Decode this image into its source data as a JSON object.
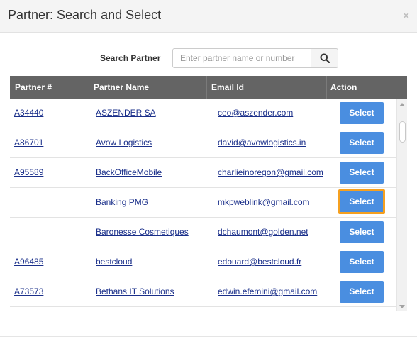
{
  "modal": {
    "title": "Partner: Search and Select",
    "close_label": "×"
  },
  "search": {
    "label": "Search Partner",
    "placeholder": "Enter partner name or number",
    "value": "",
    "button_icon": "search-icon"
  },
  "table": {
    "headers": {
      "partner_no": "Partner #",
      "partner_name": "Partner Name",
      "email": "Email Id",
      "action": "Action"
    },
    "select_label": "Select",
    "rows": [
      {
        "partner_no": "A34440",
        "partner_name": "ASZENDER SA",
        "email": "ceo@aszender.com"
      },
      {
        "partner_no": "A86701",
        "partner_name": "Avow Logistics",
        "email": "david@avowlogistics.in"
      },
      {
        "partner_no": "A95589",
        "partner_name": "BackOfficeMobile",
        "email": "charlieinoregon@gmail.com"
      },
      {
        "partner_no": "",
        "partner_name": "Banking PMG",
        "email": "mkpweblink@gmail.com",
        "focused": true
      },
      {
        "partner_no": "",
        "partner_name": "Baronesse Cosmetiques",
        "email": "dchaumont@golden.net"
      },
      {
        "partner_no": "A96485",
        "partner_name": "bestcloud",
        "email": "edouard@bestcloud.fr"
      },
      {
        "partner_no": "A73573",
        "partner_name": "Bethans IT Solutions",
        "email": "edwin.efemini@gmail.com"
      },
      {
        "partner_no": "",
        "partner_name": "",
        "email": ""
      }
    ]
  },
  "colors": {
    "header_bg": "#646464",
    "select_button": "#4a8ee0",
    "focus_ring": "#f5a020",
    "link": "#1a2f8a"
  }
}
